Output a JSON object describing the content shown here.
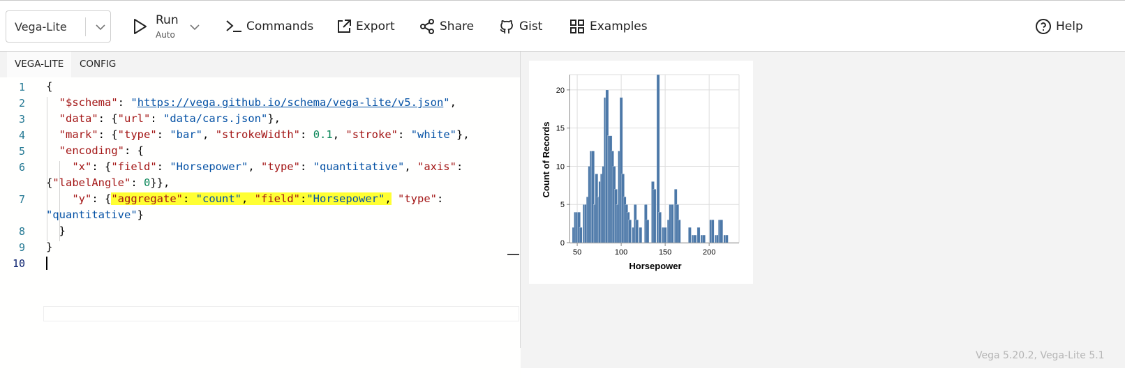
{
  "header": {
    "mode": "Vega-Lite",
    "run_label": "Run",
    "run_sub": "Auto",
    "commands_label": "Commands",
    "export_label": "Export",
    "share_label": "Share",
    "gist_label": "Gist",
    "examples_label": "Examples",
    "help_label": "Help"
  },
  "tabs": [
    "VEGA-LITE",
    "CONFIG"
  ],
  "editor": {
    "line_numbers": [
      "1",
      "2",
      "3",
      "4",
      "5",
      "6",
      "7",
      "8",
      "9",
      "10"
    ],
    "active_line": "10",
    "lines": [
      "{",
      "  \"$schema\": \"https://vega.github.io/schema/vega-lite/v5.json\",",
      "  \"data\": {\"url\": \"data/cars.json\"},",
      "  \"mark\": {\"type\": \"bar\", \"strokeWidth\": 0.1, \"stroke\": \"white\"},",
      "  \"encoding\": {",
      "    \"x\": {\"field\": \"Horsepower\", \"type\": \"quantitative\", \"axis\":",
      "{\"labelAngle\": 0}},",
      "    \"y\": {\"aggregate\": \"count\", \"field\":\"Horsepower\", \"type\":",
      "\"quantitative\"}",
      "  }",
      "}"
    ]
  },
  "footer": {
    "version": "Vega 5.20.2, Vega-Lite 5.1"
  },
  "colors": {
    "bar": "#4c78a8",
    "highlight": "#ffff33",
    "key": "#a31515",
    "string": "#0451a5",
    "number": "#098658",
    "line_number": "#237893"
  },
  "chart_data": {
    "type": "bar",
    "xlabel": "Horsepower",
    "ylabel": "Count of Records",
    "xlim": [
      42,
      234
    ],
    "ylim": [
      0,
      22
    ],
    "x_ticks": [
      50,
      100,
      150,
      200
    ],
    "y_ticks": [
      0,
      5,
      10,
      15,
      20
    ],
    "grid": true,
    "bin_width": 3.3,
    "x": [
      46,
      48,
      50,
      52,
      54,
      56,
      58,
      60,
      62,
      64,
      66,
      68,
      70,
      72,
      74,
      76,
      78,
      80,
      82,
      84,
      86,
      88,
      90,
      92,
      94,
      96,
      98,
      100,
      102,
      104,
      106,
      108,
      110,
      112,
      114,
      116,
      118,
      120,
      122,
      124,
      126,
      128,
      130,
      132,
      134,
      136,
      138,
      140,
      142,
      144,
      146,
      148,
      150,
      152,
      154,
      156,
      158,
      160,
      162,
      164,
      166,
      168,
      170,
      172,
      174,
      176,
      178,
      180,
      182,
      184,
      186,
      188,
      190,
      192,
      194,
      196,
      198,
      200,
      202,
      204,
      206,
      208,
      210,
      212,
      214,
      216,
      218,
      220,
      222,
      224,
      226,
      228,
      230,
      232
    ],
    "values": [
      2,
      4,
      4,
      4,
      2,
      0,
      5,
      5,
      6,
      10,
      12,
      12,
      5,
      9,
      6,
      8,
      9,
      10,
      19,
      20,
      14,
      14,
      12,
      10,
      7,
      5,
      12,
      19,
      9,
      6,
      5,
      4,
      3,
      0,
      2,
      5,
      3,
      0,
      2,
      0,
      0,
      5,
      3,
      0,
      0,
      8,
      7,
      0,
      22,
      4,
      0,
      2,
      2,
      0,
      3,
      5,
      5,
      0,
      7,
      5,
      3,
      0,
      0,
      0,
      0,
      0,
      2,
      0,
      1,
      1,
      0,
      2,
      0,
      1,
      1,
      0,
      0,
      0,
      3,
      3,
      0,
      1,
      1,
      3,
      3,
      0,
      1,
      1,
      0,
      0,
      0,
      0,
      0,
      0
    ]
  }
}
